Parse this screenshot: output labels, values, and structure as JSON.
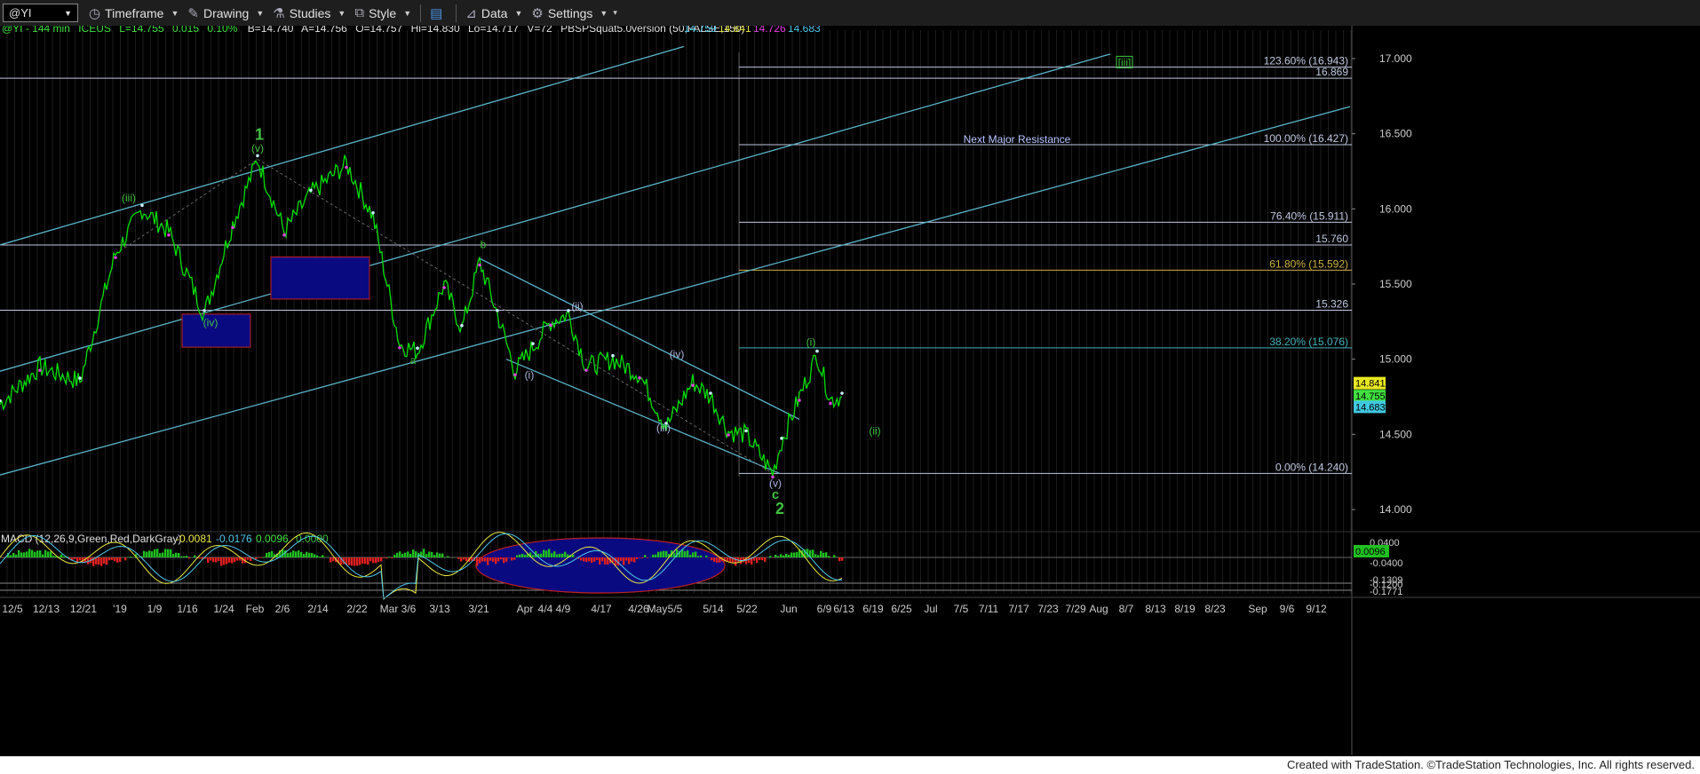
{
  "toolbar": {
    "symbol": "@YI",
    "items": [
      {
        "name": "timeframe",
        "label": "Timeframe"
      },
      {
        "name": "drawing",
        "label": "Drawing"
      },
      {
        "name": "studies",
        "label": "Studies"
      },
      {
        "name": "style",
        "label": "Style"
      },
      {
        "name": "data",
        "label": "Data"
      },
      {
        "name": "settings",
        "label": "Settings"
      }
    ]
  },
  "header": {
    "symbol_info": "@YI - 144 min",
    "exchange": "ICEUS",
    "last": "L=14.755",
    "change": "0.015",
    "pct": "0.10%",
    "bid": "B=14.740",
    "ask": "A=14.756",
    "open": "O=14.757",
    "high": "Hi=14.830",
    "low": "Lo=14.717",
    "volume": "V=72",
    "study": "PBSPSquat5.0version (50,FALSE,150)",
    "vals": [
      {
        "text": "14.759",
        "color": "#4fc8e8"
      },
      {
        "text": "14.841",
        "color": "#e8e840"
      },
      {
        "text": "14.726",
        "color": "#e040e0"
      },
      {
        "text": "14.683",
        "color": "#4fc8e8"
      }
    ]
  },
  "footer": "Created with TradeStation. ©TradeStation Technologies, Inc. All rights reserved.",
  "chart_data": {
    "type": "line",
    "title": "@YI - 144 min",
    "ylim": [
      13.9,
      17.1
    ],
    "y_ticks": [
      "17.000",
      "16.500",
      "16.000",
      "15.500",
      "15.000",
      "14.500",
      "14.000"
    ],
    "x_ticks": [
      "12/5",
      "12/13",
      "12/21",
      "'19",
      "1/9",
      "1/16",
      "1/24",
      "Feb",
      "2/6",
      "2/14",
      "2/22",
      "Mar",
      "3/6",
      "3/13",
      "3/21",
      "Apr",
      "4/4",
      "4/9",
      "4/17",
      "4/26",
      "May",
      "5/5",
      "5/14",
      "5/22",
      "Jun",
      "6/9",
      "6/13",
      "6/19",
      "6/25",
      "Jul",
      "7/5",
      "7/11",
      "7/17",
      "7/23",
      "7/29",
      "Aug",
      "8/7",
      "8/13",
      "8/19",
      "8/23",
      "Sep",
      "9/6",
      "9/12"
    ],
    "series": [
      {
        "name": "",
        "color": "#00e000",
        "x": [
          0,
          45,
          90,
          130,
          160,
          190,
          230,
          262,
          290,
          320,
          350,
          390,
          420,
          450,
          470,
          500,
          520,
          540,
          560,
          580,
          600,
          620,
          640,
          660,
          690,
          720,
          750,
          780,
          800,
          820,
          840,
          870,
          880,
          900,
          920,
          935,
          948
        ],
        "y": [
          14.7,
          14.95,
          14.85,
          15.7,
          16.0,
          15.85,
          15.3,
          15.9,
          16.33,
          15.85,
          16.1,
          16.3,
          15.95,
          15.1,
          15.05,
          15.5,
          15.2,
          15.65,
          15.3,
          14.92,
          15.08,
          15.25,
          15.3,
          14.95,
          15.0,
          14.9,
          14.55,
          14.85,
          14.75,
          14.52,
          14.5,
          14.24,
          14.45,
          14.75,
          15.03,
          14.73,
          14.75
        ]
      }
    ],
    "levels": [
      {
        "label": "123.60% (16.943)",
        "value": 16.943,
        "color": "#c0c8e0"
      },
      {
        "label": "16.869",
        "value": 16.869,
        "color": "#c0c8e0"
      },
      {
        "label": "100.00% (16.427)",
        "value": 16.427,
        "color": "#c0c8e0"
      },
      {
        "label": "76.40% (15.911)",
        "value": 15.911,
        "color": "#c0c8e0"
      },
      {
        "label": "15.760",
        "value": 15.76,
        "color": "#c0c8e0"
      },
      {
        "label": "61.80% (15.592)",
        "value": 15.592,
        "color": "#c8b040"
      },
      {
        "label": "15.326",
        "value": 15.326,
        "color": "#c0c8e0"
      },
      {
        "label": "38.20% (15.076)",
        "value": 15.076,
        "color": "#40b0b8"
      },
      {
        "label": "0.00% (14.240)",
        "value": 14.24,
        "color": "#c0c8e0"
      }
    ],
    "price_tags": [
      {
        "text": "14.841",
        "value": 14.841,
        "bg": "#e8e820"
      },
      {
        "text": "14.755",
        "value": 14.755,
        "bg": "#40e040"
      },
      {
        "text": "14.683",
        "value": 14.683,
        "bg": "#40c8e0"
      }
    ],
    "annotations": [
      {
        "text": "Next Major Resistance",
        "x": 1145,
        "y": 16.44,
        "color": "#b8c4ff"
      },
      {
        "text": "1",
        "x": 292,
        "y": 16.46,
        "color": "#40c040",
        "size": 18
      },
      {
        "text": "(v)",
        "x": 290,
        "y": 16.38,
        "color": "#40c040"
      },
      {
        "text": "(iii)",
        "x": 145,
        "y": 16.05,
        "color": "#40c040"
      },
      {
        "text": "(iv)",
        "x": 237,
        "y": 15.22,
        "color": "#40c040"
      },
      {
        "text": "a",
        "x": 465,
        "y": 14.97,
        "color": "#40c040"
      },
      {
        "text": "b",
        "x": 544,
        "y": 15.74,
        "color": "#40c040"
      },
      {
        "text": "(ii)",
        "x": 650,
        "y": 15.33,
        "color": "#b0b8e0"
      },
      {
        "text": "(i)",
        "x": 596,
        "y": 14.87,
        "color": "#b0b8e0"
      },
      {
        "text": "(iv)",
        "x": 762,
        "y": 15.01,
        "color": "#b0b8e0"
      },
      {
        "text": "(iii)",
        "x": 747,
        "y": 14.52,
        "color": "#b0b8e0"
      },
      {
        "text": "(v)",
        "x": 873,
        "y": 14.15,
        "color": "#b0b8e0"
      },
      {
        "text": "c",
        "x": 873,
        "y": 14.07,
        "color": "#40c040",
        "size": 15
      },
      {
        "text": "2",
        "x": 878,
        "y": 13.97,
        "color": "#40c040",
        "size": 18
      },
      {
        "text": "(i)",
        "x": 913,
        "y": 15.09,
        "color": "#40c040"
      },
      {
        "text": "(ii)",
        "x": 985,
        "y": 14.5,
        "color": "#40c040"
      },
      {
        "text": "[iii]",
        "x": 1266,
        "y": 16.95,
        "color": "#40c040",
        "boxed": true
      }
    ],
    "channels": [
      {
        "x1": 0,
        "y1": 15.76,
        "x2": 770,
        "y2": 17.08
      },
      {
        "x1": 0,
        "y1": 14.23,
        "x2": 1520,
        "y2": 16.68
      },
      {
        "x1": 0,
        "y1": 14.92,
        "x2": 1250,
        "y2": 17.03
      },
      {
        "x1": 570,
        "y1": 15.0,
        "x2": 878,
        "y2": 14.24
      },
      {
        "x1": 540,
        "y1": 15.67,
        "x2": 900,
        "y2": 14.6
      }
    ],
    "boxes": [
      {
        "x1": 205,
        "x2": 282,
        "y1": 15.08,
        "y2": 15.3
      },
      {
        "x1": 305,
        "x2": 416,
        "y1": 15.4,
        "y2": 15.68
      }
    ],
    "macd": {
      "label": "MACD (12,26,9,Green,Red,DarkGray)",
      "values": [
        {
          "text": "-0.0081",
          "color": "#e8e840"
        },
        {
          "text": "-0.0176",
          "color": "#4fc8e8"
        },
        {
          "text": "0.0096",
          "color": "#40e040"
        },
        {
          "text": "0.0000",
          "color": "#40c040"
        }
      ],
      "y_ticks": [
        {
          "text": "0.0400",
          "value": 0.04
        },
        {
          "text": "0.0096",
          "value": 0.0096,
          "tag": true
        },
        {
          "text": "-0.0400",
          "value": -0.04
        },
        {
          "text": "-0.1309",
          "value": -0.1309
        },
        {
          "text": "-0.1200",
          "value": -0.12
        },
        {
          "text": "-0.1771",
          "value": -0.1771
        }
      ]
    }
  }
}
